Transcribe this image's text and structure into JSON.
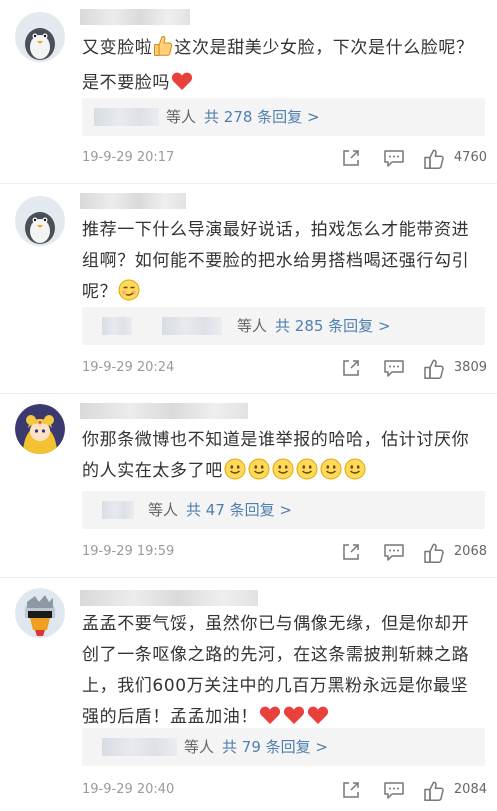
{
  "comments": [
    {
      "text_segments": [
        "又变脸啦",
        "这次是甜美少女脸，下次是什么脸呢？是不要脸吗"
      ],
      "emoji": [
        "thumbs-up-emoji",
        "red-heart-emoji"
      ],
      "reply_by": "等人",
      "reply_count": "共 278 条回复 >",
      "timestamp": "19-9-29 20:17",
      "likes": "4760"
    },
    {
      "text": "推荐一下什么导演最好说话，拍戏怎么才能带资进组啊？如何能不要脸的把水给男搭档喝还强行勾引呢？",
      "emoji": [
        "smirk-emoji"
      ],
      "reply_by": "等人",
      "reply_count": "共 285 条回复 >",
      "timestamp": "19-9-29 20:24",
      "likes": "3809"
    },
    {
      "text": "你那条微博也不知道是谁举报的哈哈，估计讨厌你的人实在太多了吧",
      "emoji": [
        "smile-emoji",
        "smile-emoji",
        "smile-emoji",
        "smile-emoji",
        "smile-emoji",
        "smile-emoji"
      ],
      "reply_by": "等人",
      "reply_count": "共 47 条回复 >",
      "timestamp": "19-9-29 19:59",
      "likes": "2068"
    },
    {
      "text": "孟孟不要气馁，虽然你已与偶像无缘，但是你却开创了一条呕像之路的先河，在这条需披荆斩棘之路上，我们600万关注中的几百万黑粉永远是你最坚强的后盾！孟孟加油！",
      "emoji": [
        "red-heart-emoji",
        "red-heart-emoji",
        "red-heart-emoji"
      ],
      "reply_by": "等人",
      "reply_count": "共 79 条回复 >",
      "timestamp": "19-9-29 20:40",
      "likes": "2084"
    }
  ],
  "colors": {
    "link_blue": "#4f7fb0",
    "meta_gray": "#9a9a9a",
    "reply_bg": "#f4f4f4",
    "heart_red": "#e8413b"
  },
  "icons": [
    "share-icon",
    "comment-icon",
    "like-icon"
  ]
}
